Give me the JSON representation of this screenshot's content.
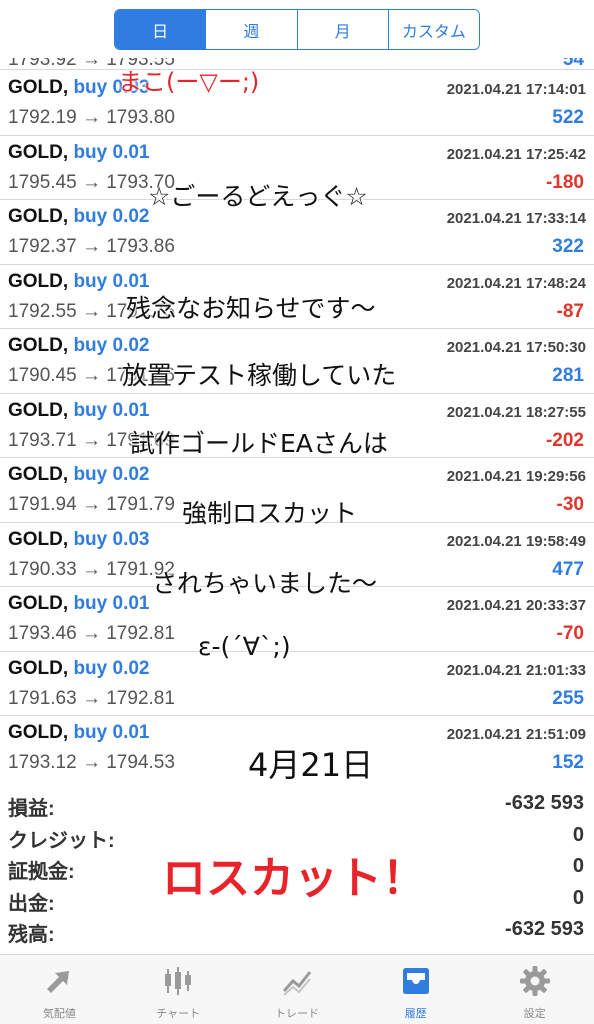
{
  "segments": [
    {
      "label": "日",
      "active": true
    },
    {
      "label": "週",
      "active": false
    },
    {
      "label": "月",
      "active": false
    },
    {
      "label": "カスタム",
      "active": false
    }
  ],
  "partial_row": {
    "prices": "1793.92 → 1793.55",
    "profit": "54"
  },
  "deals": [
    {
      "symbol": "GOLD,",
      "action": "buy 0.03",
      "time": "2021.04.21 17:14:01",
      "prices": "1792.19 → 1793.80",
      "profit": "522",
      "sign": "pos"
    },
    {
      "symbol": "GOLD,",
      "action": "buy 0.01",
      "time": "2021.04.21 17:25:42",
      "prices": "1795.45 → 1793.70",
      "profit": "-180",
      "sign": "neg"
    },
    {
      "symbol": "GOLD,",
      "action": "buy 0.02",
      "time": "2021.04.21 17:33:14",
      "prices": "1792.37 → 1793.86",
      "profit": "322",
      "sign": "pos"
    },
    {
      "symbol": "GOLD,",
      "action": "buy 0.01",
      "time": "2021.04.21 17:48:24",
      "prices": "1792.55 → 1791.75",
      "profit": "-87",
      "sign": "neg"
    },
    {
      "symbol": "GOLD,",
      "action": "buy 0.02",
      "time": "2021.04.21 17:50:30",
      "prices": "1790.45 → 1791.86",
      "profit": "281",
      "sign": "pos"
    },
    {
      "symbol": "GOLD,",
      "action": "buy 0.01",
      "time": "2021.04.21 18:27:55",
      "prices": "1793.71 → 1791.69",
      "profit": "-202",
      "sign": "neg"
    },
    {
      "symbol": "GOLD,",
      "action": "buy 0.02",
      "time": "2021.04.21 19:29:56",
      "prices": "1791.94 → 1791.79",
      "profit": "-30",
      "sign": "neg"
    },
    {
      "symbol": "GOLD,",
      "action": "buy 0.03",
      "time": "2021.04.21 19:58:49",
      "prices": "1790.33 → 1791.92",
      "profit": "477",
      "sign": "pos"
    },
    {
      "symbol": "GOLD,",
      "action": "buy 0.01",
      "time": "2021.04.21 20:33:37",
      "prices": "1793.46 → 1792.81",
      "profit": "-70",
      "sign": "neg"
    },
    {
      "symbol": "GOLD,",
      "action": "buy 0.02",
      "time": "2021.04.21 21:01:33",
      "prices": "1791.63 → 1792.81",
      "profit": "255",
      "sign": "pos"
    },
    {
      "symbol": "GOLD,",
      "action": "buy 0.01",
      "time": "2021.04.21 21:51:09",
      "prices": "1793.12 → 1794.53",
      "profit": "152",
      "sign": "pos"
    }
  ],
  "summary": [
    {
      "label": "損益:",
      "value": "-632 593"
    },
    {
      "label": "クレジット:",
      "value": "0"
    },
    {
      "label": "証拠金:",
      "value": "0"
    },
    {
      "label": "出金:",
      "value": "0"
    },
    {
      "label": "残高:",
      "value": "-632 593"
    }
  ],
  "handwriting": {
    "line0": "まこ(ー▽ー;)",
    "line1": "☆ごーるどえっぐ☆",
    "line2": "残念なお知らせです〜",
    "line3": "放置テスト稼働していた",
    "line4": "試作ゴールドEAさんは",
    "line5": "強制ロスカット",
    "line6": "されちゃいました〜",
    "line7": "ε-(´∀`;)",
    "date": "4月21日",
    "big": "ロスカット！"
  },
  "tabs": [
    {
      "label": "気配値",
      "icon": "quotes-icon",
      "active": false
    },
    {
      "label": "チャート",
      "icon": "chart-icon",
      "active": false
    },
    {
      "label": "トレード",
      "icon": "trade-icon",
      "active": false
    },
    {
      "label": "履歴",
      "icon": "history-icon",
      "active": true
    },
    {
      "label": "設定",
      "icon": "settings-icon",
      "active": false
    }
  ],
  "colors": {
    "accent": "#2f7de1",
    "loss": "#e0352b",
    "handwriting_red": "#e8232a"
  }
}
